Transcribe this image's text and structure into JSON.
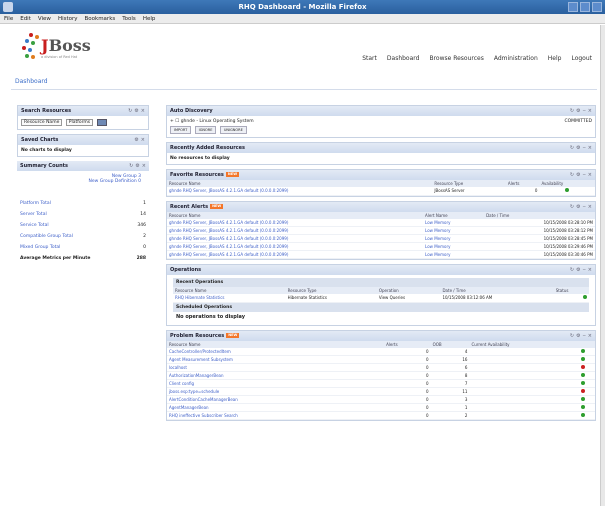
{
  "window": {
    "title": "RHQ Dashboard - Mozilla Firefox"
  },
  "menubar": [
    "File",
    "Edit",
    "View",
    "History",
    "Bookmarks",
    "Tools",
    "Help"
  ],
  "logo": {
    "text_j": "J",
    "text_rest": "Boss",
    "tagline": "a division of Red Hat"
  },
  "topnav": [
    "Start",
    "Dashboard",
    "Browse Resources",
    "Administration",
    "Help",
    "Logout"
  ],
  "breadcrumb": "Dashboard",
  "left": {
    "search": {
      "title": "Search Resources",
      "select1": "Resource Name",
      "select2": "Platforms"
    },
    "favorites": {
      "title": "Saved Charts",
      "empty": "No charts to display"
    },
    "summary": {
      "title": "Summary Counts",
      "new_group": "New Group",
      "new_group_def": "New Group Definition",
      "new_group_count": "3",
      "new_group_def_count": "0",
      "rows": [
        {
          "label": "Platform Total",
          "value": "1"
        },
        {
          "label": "Server Total",
          "value": "14"
        },
        {
          "label": "Service Total",
          "value": "346"
        },
        {
          "label": "Compatible Group Total",
          "value": "2"
        },
        {
          "label": "Mixed Group Total",
          "value": "0"
        },
        {
          "label": "Average Metrics per Minute",
          "value": "288"
        }
      ]
    }
  },
  "right": {
    "auto_discovery": {
      "title": "Auto Discovery",
      "item": "ghnde - Linux Operating System",
      "status": "COMMITTED",
      "buttons": [
        "IMPORT",
        "IGNORE",
        "UNIGNORE"
      ]
    },
    "recent_added": {
      "title": "Recently Added Resources",
      "empty": "No resources to display"
    },
    "favorite_resources": {
      "title": "Favorite Resources",
      "badge": "NEW",
      "columns": [
        "Resource Name",
        "Resource Type",
        "Alerts",
        "Availability"
      ],
      "rows": [
        {
          "name": "ghnde RHQ Server, JBossAS 4.2.1.GA default (0.0.0.0:2099)",
          "type": "JBossAS Server",
          "alerts": "0"
        }
      ]
    },
    "recent_alerts": {
      "title": "Recent Alerts",
      "badge": "NEW",
      "columns": [
        "Resource Name",
        "Alert Name",
        "Date / Time"
      ],
      "rows": [
        {
          "name": "ghnde RHQ Server, JBossAS 4.2.1.GA default (0.0.0.0:2099)",
          "alert": "Low Memory",
          "time": "10/15/2008 03:28:10 PM"
        },
        {
          "name": "ghnde RHQ Server, JBossAS 4.2.1.GA default (0.0.0.0:2099)",
          "alert": "Low Memory",
          "time": "10/15/2008 03:28:12 PM"
        },
        {
          "name": "ghnde RHQ Server, JBossAS 4.2.1.GA default (0.0.0.0:2099)",
          "alert": "Low Memory",
          "time": "10/15/2008 03:28:45 PM"
        },
        {
          "name": "ghnde RHQ Server, JBossAS 4.2.1.GA default (0.0.0.0:2099)",
          "alert": "Low Memory",
          "time": "10/15/2008 03:29:46 PM"
        },
        {
          "name": "ghnde RHQ Server, JBossAS 4.2.1.GA default (0.0.0.0:2099)",
          "alert": "Low Memory",
          "time": "10/15/2008 03:30:46 PM"
        }
      ]
    },
    "operations": {
      "title": "Operations",
      "recent_title": "Recent Operations",
      "columns": [
        "Resource Name",
        "Resource Type",
        "Operation",
        "Date / Time",
        "Status"
      ],
      "rows": [
        {
          "name": "RHQ Hibernate Statistics",
          "type": "Hibernate Statistics",
          "op": "View Queries",
          "time": "10/15/2008 03:12:06 AM"
        }
      ],
      "scheduled_title": "Scheduled Operations",
      "scheduled_empty": "No operations to display"
    },
    "problem_resources": {
      "title": "Problem Resources",
      "badge": "NEW",
      "columns": [
        "Resource Name",
        "Alerts",
        "OOB",
        "Current Availability"
      ],
      "rows": [
        {
          "name": "CacheController/ProtectedItem",
          "alerts": "0",
          "oob": "4",
          "avail": "up"
        },
        {
          "name": "Agent Measurement Subsystem",
          "alerts": "0",
          "oob": "16",
          "avail": "up"
        },
        {
          "name": "localhost",
          "alerts": "0",
          "oob": "6",
          "avail": "down"
        },
        {
          "name": "AuthorizationManagerBean",
          "alerts": "0",
          "oob": "8",
          "avail": "up"
        },
        {
          "name": "Client config",
          "alerts": "0",
          "oob": "7",
          "avail": "up"
        },
        {
          "name": "jboss.esp:type=schedule",
          "alerts": "0",
          "oob": "11",
          "avail": "down"
        },
        {
          "name": "AlertConditionCacheManagerBean",
          "alerts": "0",
          "oob": "3",
          "avail": "up"
        },
        {
          "name": "AgentManagerBean",
          "alerts": "0",
          "oob": "1",
          "avail": "up"
        },
        {
          "name": "RHQ ineffective Subscriber Search",
          "alerts": "0",
          "oob": "2",
          "avail": "up"
        }
      ]
    }
  },
  "colors": {
    "link": "#3c5ec8",
    "badge": "#f3762a",
    "up": "#2e9e2e",
    "down": "#cc2222",
    "header": "#cfdbee"
  }
}
